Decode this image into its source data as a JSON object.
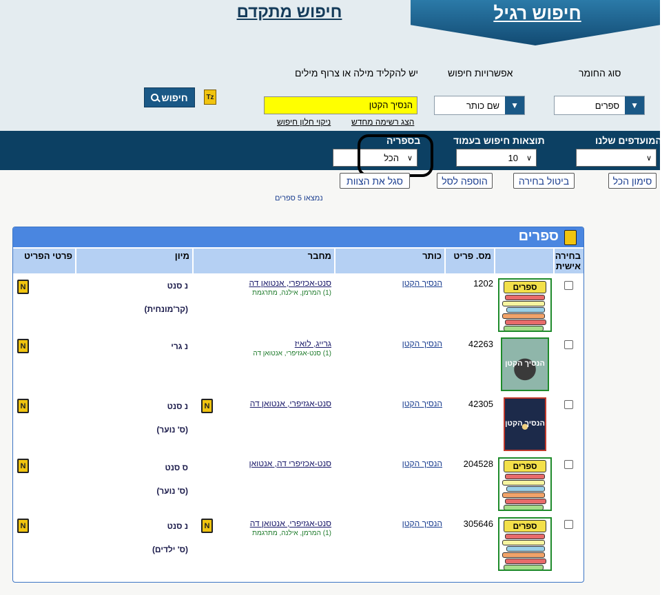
{
  "tabs": {
    "advanced": "חיפוש מתקדם",
    "regular": "חיפוש רגיל"
  },
  "search": {
    "material_type_label": "סוג החומר",
    "material_type_value": "ספרים",
    "options_label": "אפשרויות חיפוש",
    "options_value": "שם כותר",
    "query_label": "יש להקליד מילה או צרוף מילים",
    "query_value": "הנסיך הקטן",
    "show_new_list": "הצג רשימה מחדש",
    "clear_window": "ניקוי חלון חיפוש",
    "search_button": "חיפוש",
    "tz_icon": "Tz"
  },
  "filters": {
    "clubs_label": "המועדפים שלנו",
    "clubs_value": "",
    "per_page_label": "תוצאות חיפוש בעמוד",
    "per_page_value": "10",
    "library_label": "בספריה",
    "library_value": "הכל"
  },
  "actions": {
    "select_all": "סימון הכל",
    "cancel_selection": "ביטול בחירה",
    "add_to_basket": "הוספה לסל",
    "show_recommendations": "סגל את הצוות"
  },
  "results": {
    "found_text": "נמצאו 5 ספרים",
    "panel_title": "ספרים",
    "columns": {
      "selection": "בחירה אישית",
      "inventory": "מס. פריט",
      "title": "כותר",
      "author": "מחבר",
      "classification": "מיון",
      "details": "פרטי הפריט"
    },
    "cover_caption": "ספרים",
    "n_icon": "N",
    "rows": [
      {
        "inventory": "1202",
        "title": "הנסיך הקטן",
        "author": "סנט-אכזיפרי, אנטואן דה",
        "translator": "(1) המרמן, אילנה, מתרגמת",
        "class1": "נ סנט",
        "class2": "(קר'מונחית)",
        "cover": "stack"
      },
      {
        "inventory": "42263",
        "title": "הנסיך הקטן",
        "author": "גרייג, לואיז",
        "translator": "(1) סנט-אגזיפרי, אנטואן דה",
        "class1": "נ גרי",
        "class2": "",
        "cover": "green",
        "cover_text": "הנסיך הקטן"
      },
      {
        "inventory": "42305",
        "title": "הנסיך הקטן",
        "author": "סנט-אגזיפרי, אנטואן דה",
        "translator": "",
        "class1": "נ סנט",
        "class2": "(ס' נוער)",
        "cover": "dark",
        "cover_text": "הנסיך הקטן"
      },
      {
        "inventory": "204528",
        "title": "הנסיך הקטן",
        "author": "סנט-אכזיפרי דה, אנטואן",
        "translator": "",
        "class1": "ס סנט",
        "class2": "(ס' נוער)",
        "cover": "stack"
      },
      {
        "inventory": "305646",
        "title": "הנסיך הקטן",
        "author": "סנט-אגזיפרי, אנטואן דה",
        "translator": "(1) המרמן, אילנה, מתרגמת",
        "class1": "נ סנט",
        "class2": "(ס' ילדים)",
        "cover": "stack"
      }
    ]
  }
}
